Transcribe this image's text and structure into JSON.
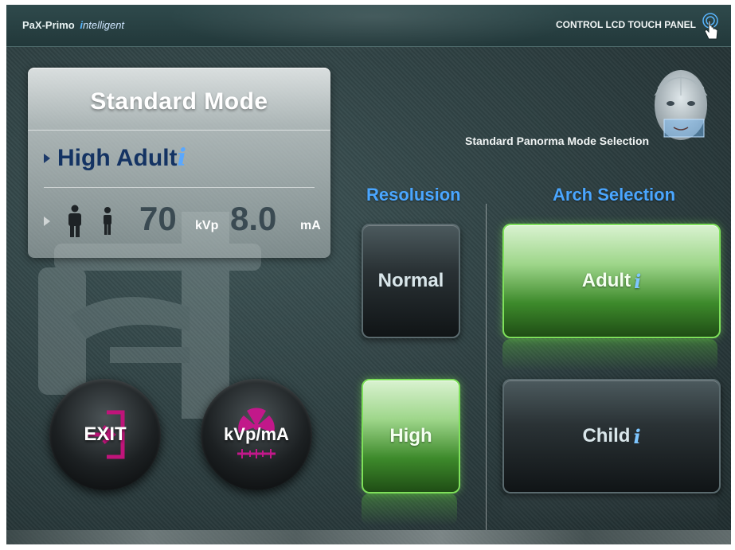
{
  "header": {
    "brand_prefix": "PaX-Primo",
    "brand_i": "i",
    "brand_suffix": "ntelligent",
    "panel_title": "CONTROL LCD TOUCH PANEL"
  },
  "mode_card": {
    "title": "Standard Mode",
    "submode": "High Adult",
    "info_glyph": "i",
    "kvp_value": "70",
    "kvp_unit": "kVp",
    "ma_value": "8.0",
    "ma_unit": "mA"
  },
  "mode_selection": {
    "label": "Standard Panorma Mode Selection"
  },
  "resolution": {
    "heading": "Resolusion",
    "options": [
      {
        "label": "Normal",
        "selected": false
      },
      {
        "label": "High",
        "selected": true
      }
    ]
  },
  "arch": {
    "heading": "Arch Selection",
    "options": [
      {
        "label": "Adult",
        "selected": true
      },
      {
        "label": "Child",
        "selected": false
      }
    ],
    "info_glyph": "i"
  },
  "round_buttons": {
    "exit_label": "EXIT",
    "kvp_label": "kVp/mA"
  },
  "icons": {
    "touch": "touch-finger-icon",
    "adult": "adult-figure-icon",
    "child": "child-figure-icon",
    "face": "patient-face-icon",
    "exit": "exit-door-icon",
    "radiation": "radiation-icon"
  },
  "colors": {
    "accent_blue": "#4aa6ff",
    "selected_green": "#7ee05a",
    "exit_magenta": "#c0147a",
    "radiation_magenta": "#c2188a"
  }
}
